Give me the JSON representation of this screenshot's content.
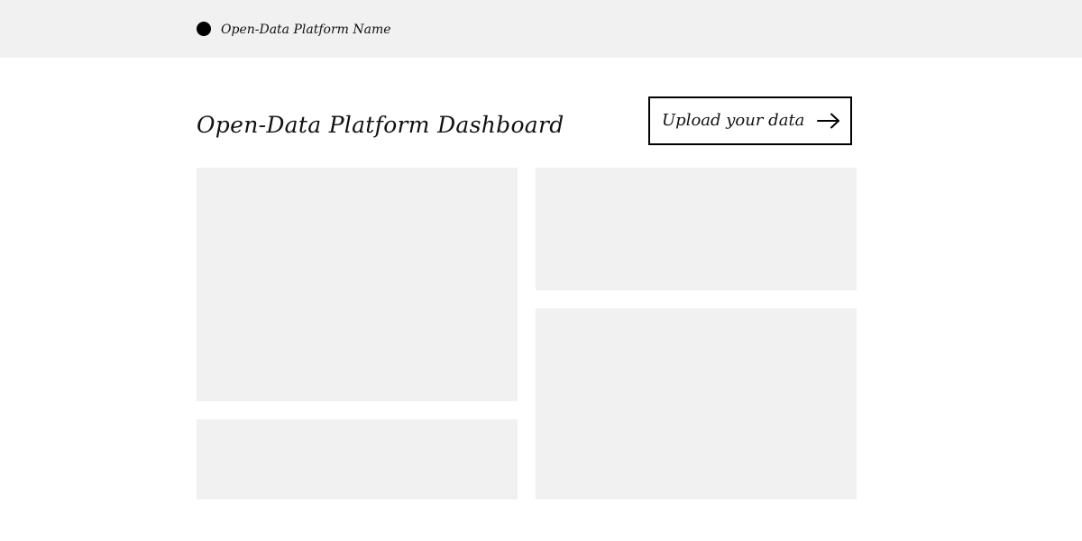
{
  "header": {
    "platform_name": "Open-Data Platform Name",
    "logo_icon": "filled-circle-logo"
  },
  "main": {
    "title": "Open-Data Platform Dashboard",
    "upload_button": {
      "label": "Upload your data",
      "icon": "arrow-right-icon"
    }
  },
  "colors": {
    "header_background": "#f1f1f1",
    "card_placeholder": "#f1f1f1",
    "button_border": "#000000",
    "text": "#111111"
  }
}
